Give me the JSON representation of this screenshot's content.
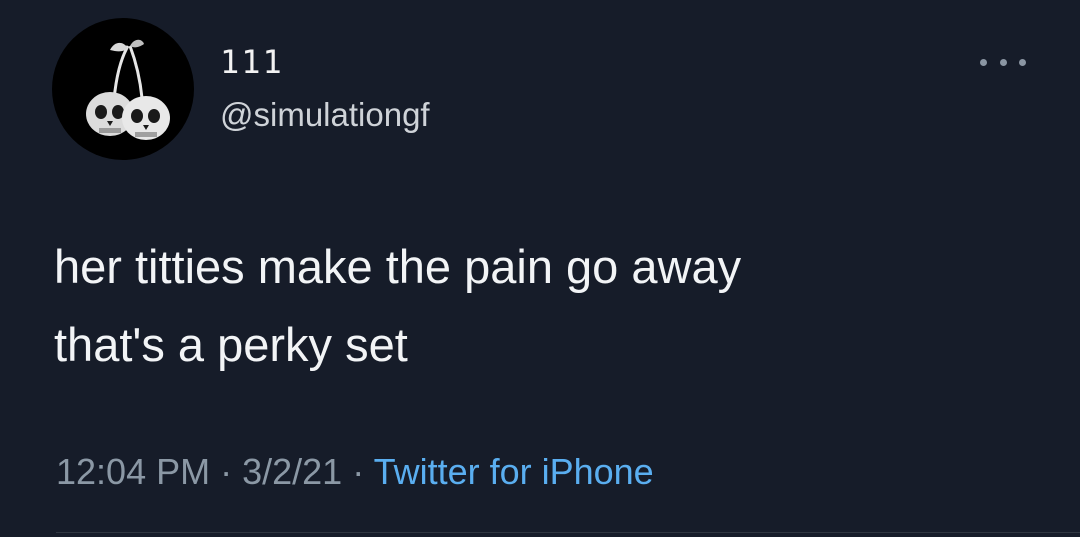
{
  "tweet": {
    "author": {
      "display_name": "111",
      "handle": "@simulationgf",
      "avatar_icon": "skull-cherries-icon"
    },
    "more_icon": "more-options-icon",
    "text_lines": [
      "her titties make the pain go away",
      "that's a perky set"
    ],
    "meta": {
      "time": "12:04 PM",
      "separator": "·",
      "date": "3/2/21",
      "source": "Twitter for iPhone"
    }
  },
  "colors": {
    "background": "#161c29",
    "primary_text": "#f2f4f6",
    "secondary_text": "#8b98a5",
    "link": "#5aaef0"
  }
}
